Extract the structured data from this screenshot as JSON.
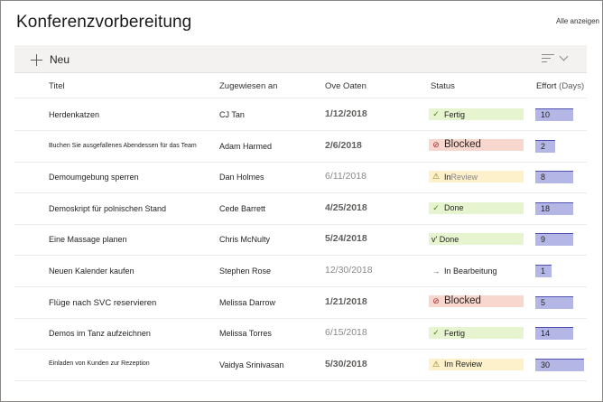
{
  "page": {
    "title": "Konferenzvorbereitung",
    "show_all": "Alle anzeigen"
  },
  "toolbar": {
    "new_label": "Neu",
    "icons": {
      "new": "plus-icon",
      "view": "view-options-icon"
    }
  },
  "columns": {
    "title": "Titel",
    "assigned": "Zugewiesen an",
    "due": "Ove Oaten",
    "status": "Status",
    "effort": "Effort",
    "effort_unit": "(Days)"
  },
  "colors": {
    "status_done": "#e6f5d0",
    "status_blocked": "#f8d7cf",
    "status_review": "#fdf1cc",
    "effort_bar": "#b4b7e6",
    "effort_line": "#4f52b2"
  },
  "rows": [
    {
      "title": "Herdenkatzen",
      "assigned": "CJ Tan",
      "due": "1/12/2018",
      "status": "Fertig",
      "status_icon": "check-icon",
      "status_type": "green",
      "effort": "10",
      "effort_fraction": 0.72
    },
    {
      "title": "Buchen Sie ausgefallenes Abendessen für das Team",
      "assigned": "Adam Harmed",
      "due": "2/6/2018",
      "status": "Blocked",
      "status_icon": "error-icon",
      "status_type": "red",
      "effort": "2",
      "effort_fraction": 0.38
    },
    {
      "title": "Demoumgebung sperren",
      "assigned": "Dan Holmes",
      "due": "6/11/2018",
      "status": "In",
      "status_extra": "Review",
      "status_icon": "warning-icon",
      "status_type": "yellow",
      "effort": "8",
      "effort_fraction": 0.72
    },
    {
      "title": "Demoskript für polnischen Stand",
      "assigned": "Cede Barrett",
      "due": "4/25/2018",
      "status": "Done",
      "status_icon": "check-icon",
      "status_type": "green",
      "effort": "18",
      "effort_fraction": 0.72
    },
    {
      "title": "Eine Massage planen",
      "assigned": "Chris McNulty",
      "due": "5/24/2018",
      "status": "v' Done",
      "status_icon": "",
      "status_type": "green",
      "effort": "9",
      "effort_fraction": 0.72
    },
    {
      "title": "Neuen Kalender kaufen",
      "assigned": "Stephen Rose",
      "due": "12/30/2018",
      "status": "In Bearbeitung",
      "status_icon": "arrow-right-icon",
      "status_type": "none",
      "effort": "1",
      "effort_fraction": 0.31
    },
    {
      "title": "Flüge nach SVC reservieren",
      "assigned": "Melissa Darrow",
      "due": "1/21/2018",
      "status": "Blocked",
      "status_icon": "error-icon",
      "status_type": "red",
      "effort": "5",
      "effort_fraction": 0.72
    },
    {
      "title": "Demos im Tanz aufzeichnen",
      "assigned": "Melissa Torres",
      "due": "6/15/2018",
      "status": "Fertig",
      "status_icon": "check-icon",
      "status_type": "green",
      "effort": "14",
      "effort_fraction": 0.72
    },
    {
      "title": "Einladen von Kunden zur Rezeption",
      "assigned": "Vaidya Srinivasan",
      "due": "5/30/2018",
      "status": "Im Review",
      "status_icon": "warning-icon",
      "status_type": "yellow",
      "effort": "30",
      "effort_fraction": 0.93
    }
  ]
}
